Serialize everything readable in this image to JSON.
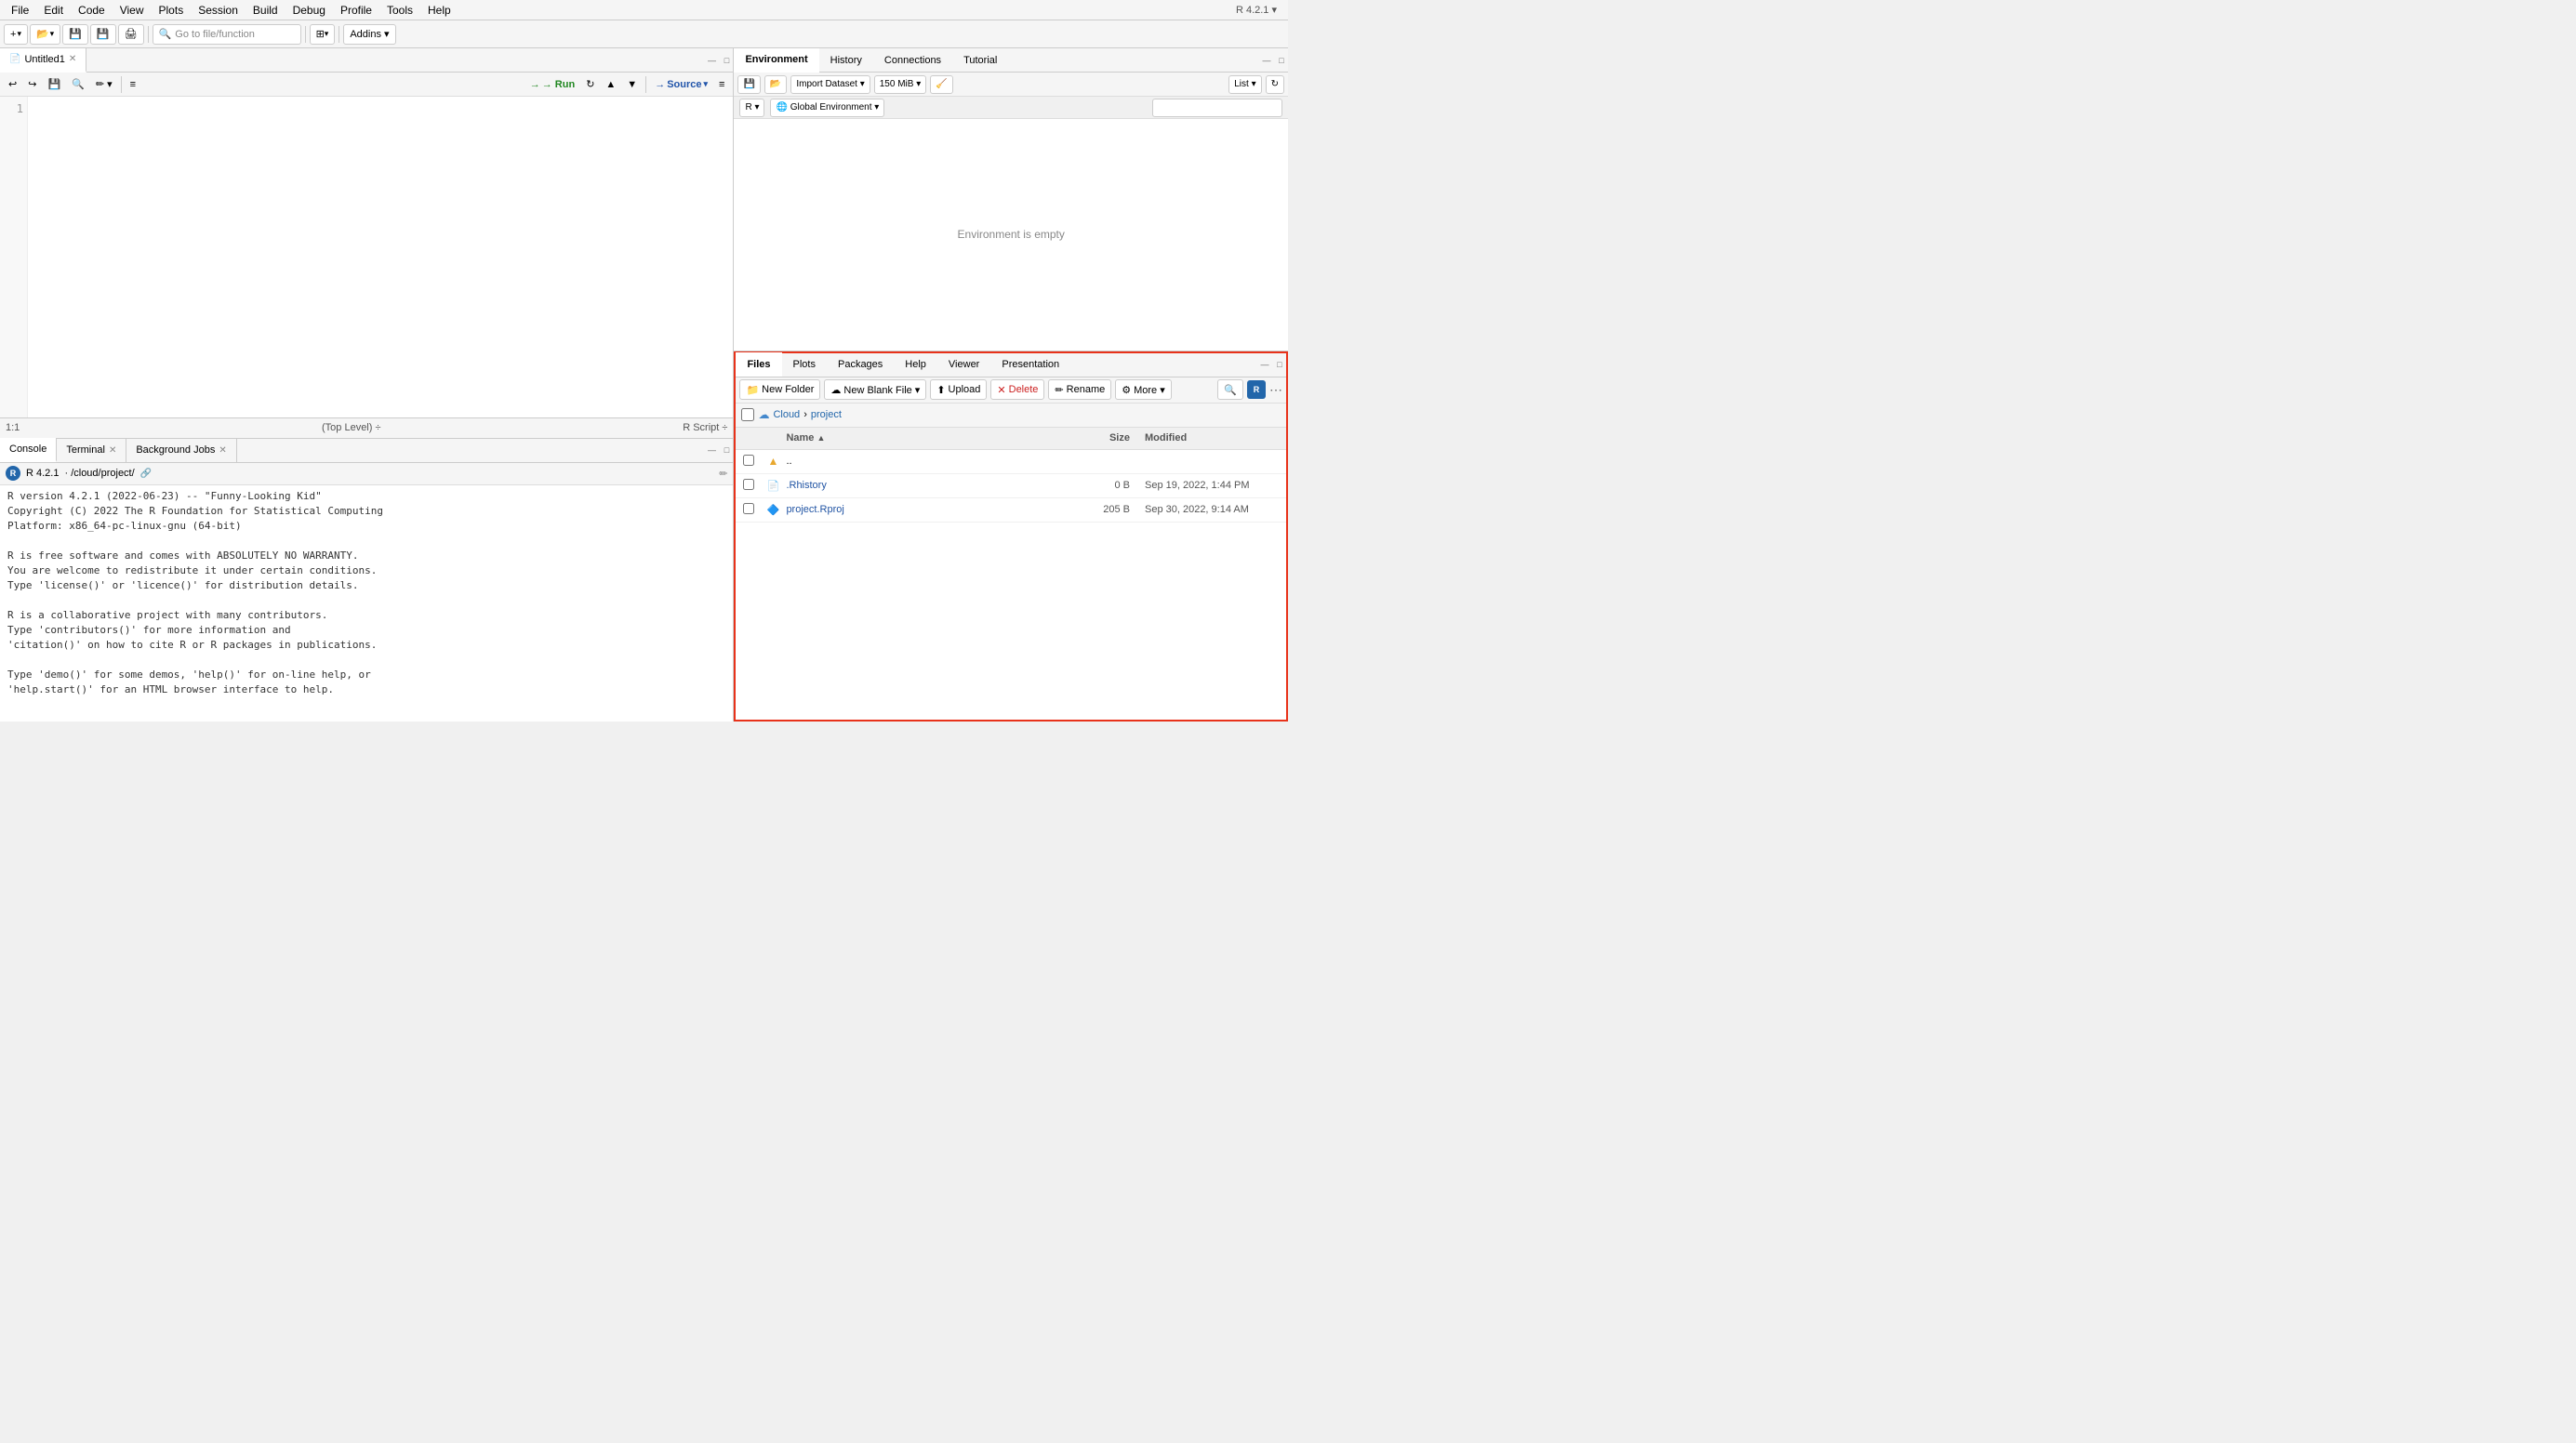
{
  "menubar": {
    "items": [
      "File",
      "Edit",
      "Code",
      "View",
      "Plots",
      "Session",
      "Build",
      "Debug",
      "Profile",
      "Tools",
      "Help"
    ]
  },
  "toolbar": {
    "new_btn": "+",
    "open_btn": "📂",
    "save_btn": "💾",
    "save_all_btn": "💾",
    "print_btn": "🖨",
    "go_to_file": "Go to file/function",
    "workspace_btn": "⊞",
    "addins_btn": "Addins ▾",
    "r_version": "R 4.2.1 ▾"
  },
  "editor": {
    "tab_name": "Untitled1",
    "toolbar": {
      "run_btn": "→ Run",
      "rerun_btn": "↻",
      "up_btn": "▲",
      "down_btn": "▼",
      "source_btn": "Source",
      "source_arrow": "▾",
      "options_btn": "≡"
    },
    "line_numbers": [
      "1"
    ],
    "status": {
      "position": "1:1",
      "scope": "(Top Level) ÷",
      "filetype": "R Script ÷"
    }
  },
  "console": {
    "tabs": [
      {
        "label": "Console",
        "active": true
      },
      {
        "label": "Terminal",
        "close": true
      },
      {
        "label": "Background Jobs",
        "close": true
      }
    ],
    "header": {
      "r_version": "R 4.2.1",
      "path": "· /cloud/project/"
    },
    "content": "R version 4.2.1 (2022-06-23) -- \"Funny-Looking Kid\"\nCopyright (C) 2022 The R Foundation for Statistical Computing\nPlatform: x86_64-pc-linux-gnu (64-bit)\n\nR is free software and comes with ABSOLUTELY NO WARRANTY.\nYou are welcome to redistribute it under certain conditions.\nType 'license()' or 'licence()' for distribution details.\n\nR is a collaborative project with many contributors.\nType 'contributors()' for more information and\n'citation()' on how to cite R or R packages in publications.\n\nType 'demo()' for some demos, 'help()' for on-line help, or\n'help.start()' for an HTML browser interface to help."
  },
  "environment": {
    "tabs": [
      "Environment",
      "History",
      "Connections",
      "Tutorial"
    ],
    "active_tab": "Environment",
    "toolbar": {
      "save_btn": "💾",
      "load_btn": "📂",
      "import_btn": "Import Dataset ▾",
      "memory_btn": "150 MiB ▾",
      "broom_btn": "🧹",
      "list_btn": "List ▾",
      "refresh_btn": "↻"
    },
    "header": {
      "r_btn": "R ▾",
      "env_btn": "🌐 Global Environment ▾",
      "search_placeholder": ""
    },
    "empty_message": "Environment is empty"
  },
  "files": {
    "tabs": [
      "Files",
      "Plots",
      "Packages",
      "Help",
      "Viewer",
      "Presentation"
    ],
    "active_tab": "Files",
    "toolbar": {
      "new_folder_btn": "New Folder",
      "new_file_btn": "New Blank File ▾",
      "upload_btn": "Upload",
      "delete_btn": "Delete",
      "rename_btn": "Rename",
      "more_btn": "More ▾"
    },
    "breadcrumb": {
      "cloud": "Cloud",
      "separator": "›",
      "project": "project"
    },
    "table_headers": [
      "",
      "",
      "Name ▲",
      "Size",
      "Modified"
    ],
    "rows": [
      {
        "check": false,
        "icon": "folder-up",
        "name": "..",
        "name_link": false,
        "size": "",
        "modified": ""
      },
      {
        "check": false,
        "icon": "rhistory",
        "name": ".Rhistory",
        "name_link": true,
        "size": "0 B",
        "modified": "Sep 19, 2022, 1:44 PM"
      },
      {
        "check": false,
        "icon": "rproj",
        "name": "project.Rproj",
        "name_link": true,
        "size": "205 B",
        "modified": "Sep 30, 2022, 9:14 AM"
      }
    ]
  }
}
